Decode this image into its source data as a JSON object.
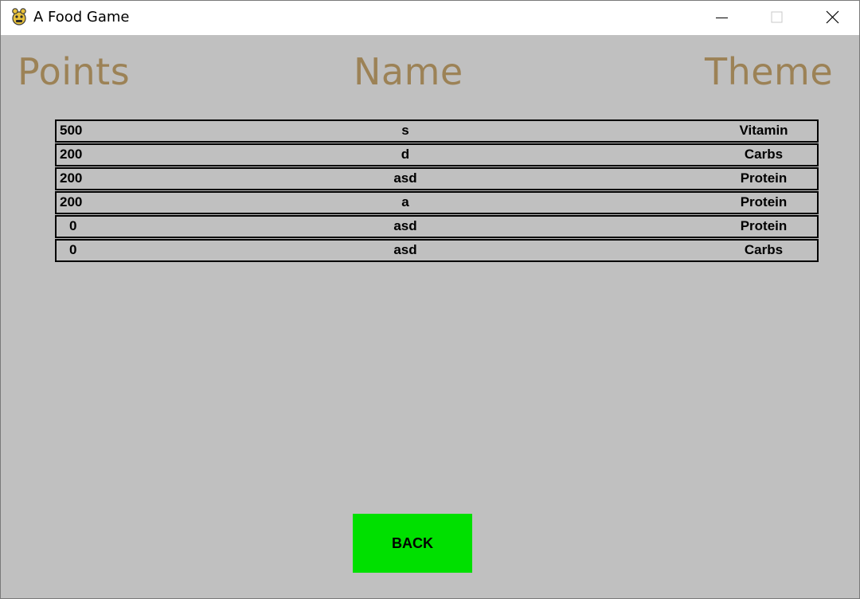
{
  "window": {
    "title": "A Food Game",
    "icon": "pygame-snake-icon",
    "controls": {
      "minimize_icon": "minimize-icon",
      "maximize_icon": "maximize-icon",
      "close_icon": "close-icon"
    }
  },
  "headers": {
    "points": "Points",
    "name": "Name",
    "theme": "Theme",
    "color": "#9c8256"
  },
  "scores": [
    {
      "points": "500",
      "name": "s",
      "theme": "Vitamin"
    },
    {
      "points": "200",
      "name": "d",
      "theme": "Carbs"
    },
    {
      "points": "200",
      "name": "asd",
      "theme": "Protein"
    },
    {
      "points": "200",
      "name": "a",
      "theme": "Protein"
    },
    {
      "points": "0",
      "name": "asd",
      "theme": "Protein"
    },
    {
      "points": "0",
      "name": "asd",
      "theme": "Carbs"
    }
  ],
  "back_button": {
    "label": "BACK",
    "color": "#00e000"
  },
  "colors": {
    "background": "#c0c0c0",
    "row_border": "#000000"
  }
}
